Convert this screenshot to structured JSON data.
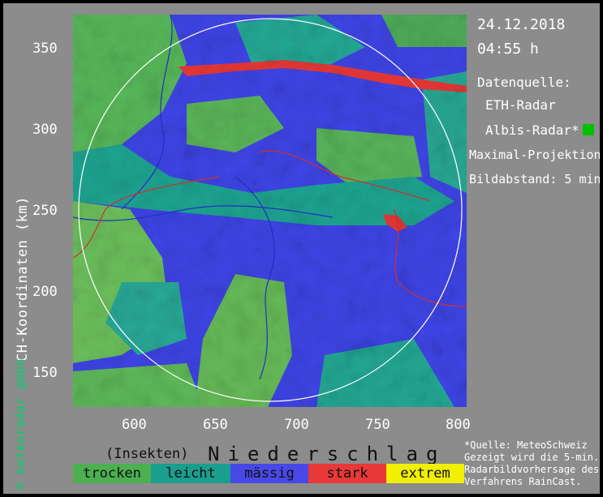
{
  "header": {
    "date": "24.12.2018",
    "time": "04:55 h"
  },
  "info": {
    "source_label": "Datenquelle:",
    "radar1": "ETH-Radar",
    "radar2": "Albis-Radar*",
    "projection": "Maximal-Projektion",
    "interval": "Bildabstand: 5 min"
  },
  "axes": {
    "ylabel": "CH-Koordinaten (km)",
    "yticks": [
      "350",
      "300",
      "250",
      "200",
      "150"
    ],
    "xticks": [
      "600",
      "650",
      "700",
      "750",
      "800"
    ],
    "xrange": [
      562,
      803
    ],
    "yrange": [
      129,
      372
    ]
  },
  "credit": "© meteoradar gmbh",
  "legend": {
    "insect_label": "(Insekten)",
    "title": "Niederschlag",
    "items": [
      {
        "label": "trocken",
        "color": "#4caf50"
      },
      {
        "label": "leicht",
        "color": "#1a9e8e"
      },
      {
        "label": "mässig",
        "color": "#4848e8"
      },
      {
        "label": "stark",
        "color": "#e83838"
      },
      {
        "label": "extrem",
        "color": "#f0f000"
      }
    ]
  },
  "footnote": {
    "line1": "*Quelle: MeteoSchweiz",
    "line2": "Gezeigt wird die 5-min.",
    "line3": "Radarbildvorhersage des",
    "line4": "Verfahrens RainCast."
  },
  "colors": {
    "radar2_marker": "#00c000",
    "background": "#8c8c8c"
  }
}
